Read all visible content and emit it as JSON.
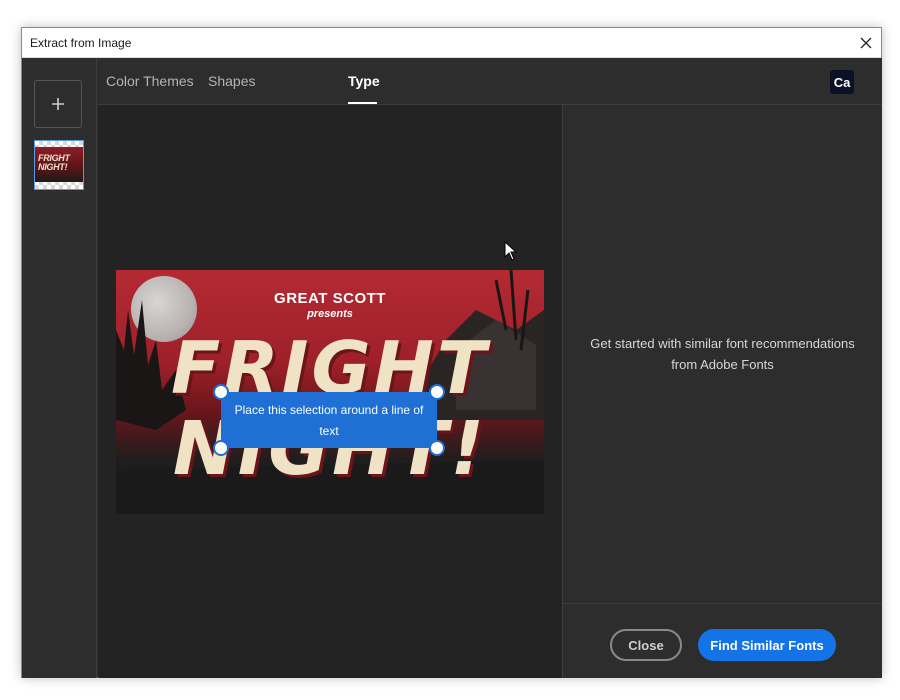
{
  "window": {
    "title": "Extract from Image"
  },
  "left_rail": {
    "add_button_label": "+",
    "thumbnail_caption": "FRIGHT NIGHT!"
  },
  "tabs": [
    {
      "label": "Color Themes",
      "active": false
    },
    {
      "label": "Shapes",
      "active": false
    },
    {
      "label": "Type",
      "active": true
    }
  ],
  "app_badge": "Ca",
  "artwork": {
    "line1": "GREAT SCOTT",
    "line2": "presents",
    "big_line1": "FRIGHT",
    "big_line2": "NIGHT!"
  },
  "selection": {
    "instruction": "Place this selection around a line of text"
  },
  "right_panel": {
    "message": "Get started with similar font recommendations from Adobe Fonts"
  },
  "footer": {
    "close_label": "Close",
    "find_label": "Find Similar Fonts"
  },
  "colors": {
    "accent": "#1473e6",
    "selection": "#1f6fd4",
    "background": "#2d2d2d",
    "canvas": "#232323"
  }
}
